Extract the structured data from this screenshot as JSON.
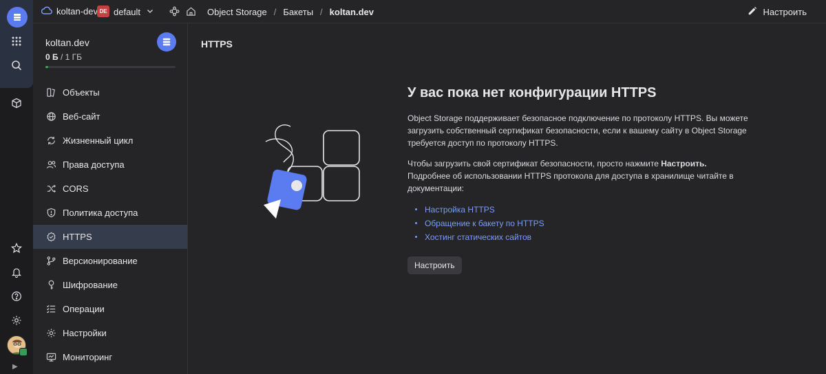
{
  "header": {
    "cloud": "koltan-dev",
    "folder_badge": "DE",
    "folder": "default",
    "breadcrumbs": [
      "Object Storage",
      "Бакеты",
      "koltan.dev"
    ],
    "configure": "Настроить"
  },
  "bucket": {
    "name": "koltan.dev",
    "used": "0 Б",
    "total": "1 ГБ",
    "usage_fraction": 0.0
  },
  "nav": {
    "items": [
      {
        "label": "Объекты",
        "icon": "objects-icon"
      },
      {
        "label": "Веб-сайт",
        "icon": "globe-icon"
      },
      {
        "label": "Жизненный цикл",
        "icon": "lifecycle-icon"
      },
      {
        "label": "Права доступа",
        "icon": "users-icon"
      },
      {
        "label": "CORS",
        "icon": "shuffle-icon"
      },
      {
        "label": "Политика доступа",
        "icon": "shield-icon"
      },
      {
        "label": "HTTPS",
        "icon": "badge-check-icon",
        "active": true
      },
      {
        "label": "Версионирование",
        "icon": "branch-icon"
      },
      {
        "label": "Шифрование",
        "icon": "key-icon"
      },
      {
        "label": "Операции",
        "icon": "list-icon"
      },
      {
        "label": "Настройки",
        "icon": "gear-icon"
      },
      {
        "label": "Мониторинг",
        "icon": "monitor-icon"
      }
    ]
  },
  "main": {
    "section_title": "HTTPS",
    "empty_title": "У вас пока нет конфигурации HTTPS",
    "para1": "Object Storage поддерживает безопасное подключение по протоколу HTTPS. Вы можете загрузить собственный сертификат безопасности, если к вашему сайту в Object Storage требуется доступ по протоколу HTTPS.",
    "para2_pre": "Чтобы загрузить свой сертификат безопасности, просто нажмите ",
    "para2_bold": "Настроить.",
    "para2_post": " Подробнее об использовании HTTPS протокола для доступа в хранилище читайте в документации:",
    "links": [
      "Настройка HTTPS",
      "Обращение к бакету по HTTPS",
      "Хостинг статических сайтов"
    ],
    "button": "Настроить"
  },
  "colors": {
    "background": "#252528",
    "accent": "#5b7cf0",
    "link": "#7c9cf8",
    "active_nav": "#353c4c",
    "folder_badge": "#c4413f"
  }
}
